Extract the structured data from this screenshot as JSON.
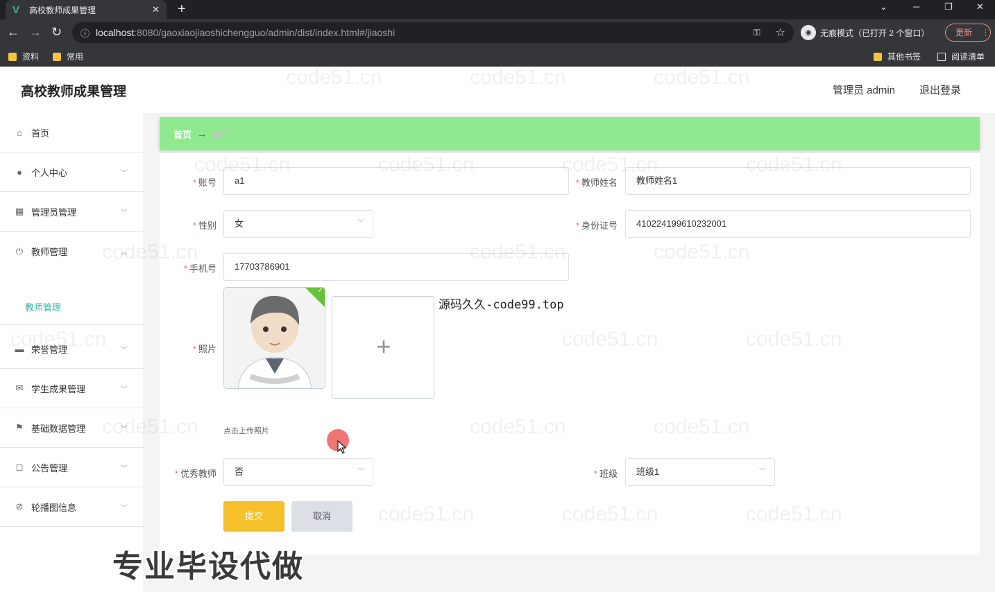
{
  "browser": {
    "tab_title": "高校教师成果管理",
    "tab_close": "✕",
    "new_tab": "+",
    "url_host": "localhost",
    "url_path": ":8080/gaoxiaojiaoshichengguo/admin/dist/index.html#/jiaoshi",
    "incognito_label": "无痕模式（已打开 2 个窗口）",
    "update_label": "更新",
    "bookmarks": [
      "资料",
      "常用"
    ],
    "other_bookmarks": "其他书签",
    "reading_list": "阅读清单"
  },
  "header": {
    "title": "高校教师成果管理",
    "admin_label": "管理员 admin",
    "logout_label": "退出登录"
  },
  "sidebar": {
    "items": [
      {
        "label": "首页",
        "icon": "home-icon",
        "glyph": "⌂"
      },
      {
        "label": "个人中心",
        "icon": "user-icon",
        "glyph": "●"
      },
      {
        "label": "管理员管理",
        "icon": "grid-icon",
        "glyph": "▦"
      },
      {
        "label": "教师管理",
        "icon": "power-icon",
        "glyph": "⏻"
      },
      {
        "label": "荣誉管理",
        "icon": "chat-icon",
        "glyph": "▬"
      },
      {
        "label": "学生成果管理",
        "icon": "mail-icon",
        "glyph": "✉"
      },
      {
        "label": "基础数据管理",
        "icon": "flag-icon",
        "glyph": "⚑"
      },
      {
        "label": "公告管理",
        "icon": "frame-icon",
        "glyph": "◻"
      },
      {
        "label": "轮播图信息",
        "icon": "bell-off-icon",
        "glyph": "⊘"
      }
    ],
    "submenu_active": "教师管理"
  },
  "breadcrumb": {
    "home": "首页",
    "separator": "→",
    "current": "教师"
  },
  "form": {
    "account_label": "账号",
    "account_value": "a1",
    "name_label": "教师姓名",
    "name_value": "教师姓名1",
    "gender_label": "性别",
    "gender_value": "女",
    "idcard_label": "身份证号",
    "idcard_value": "410224199610232001",
    "phone_label": "手机号",
    "phone_value": "17703786901",
    "photo_label": "照片",
    "upload_plus": "+",
    "upload_tip": "点击上传照片",
    "excellent_label": "优秀教师",
    "excellent_value": "否",
    "class_label": "班级",
    "class_value": "班级1",
    "submit_label": "提交",
    "cancel_label": "取消",
    "required_mark": "*"
  },
  "overlay": {
    "site_text": "源码久久-code99.top",
    "caption": "专业毕设代做",
    "watermark": "code51.cn"
  },
  "colors": {
    "breadcrumb_bg": "#8fea8f",
    "submit_bg": "#f5c02a",
    "submenu_active": "#2bb5a3",
    "required": "#f56c6c"
  }
}
